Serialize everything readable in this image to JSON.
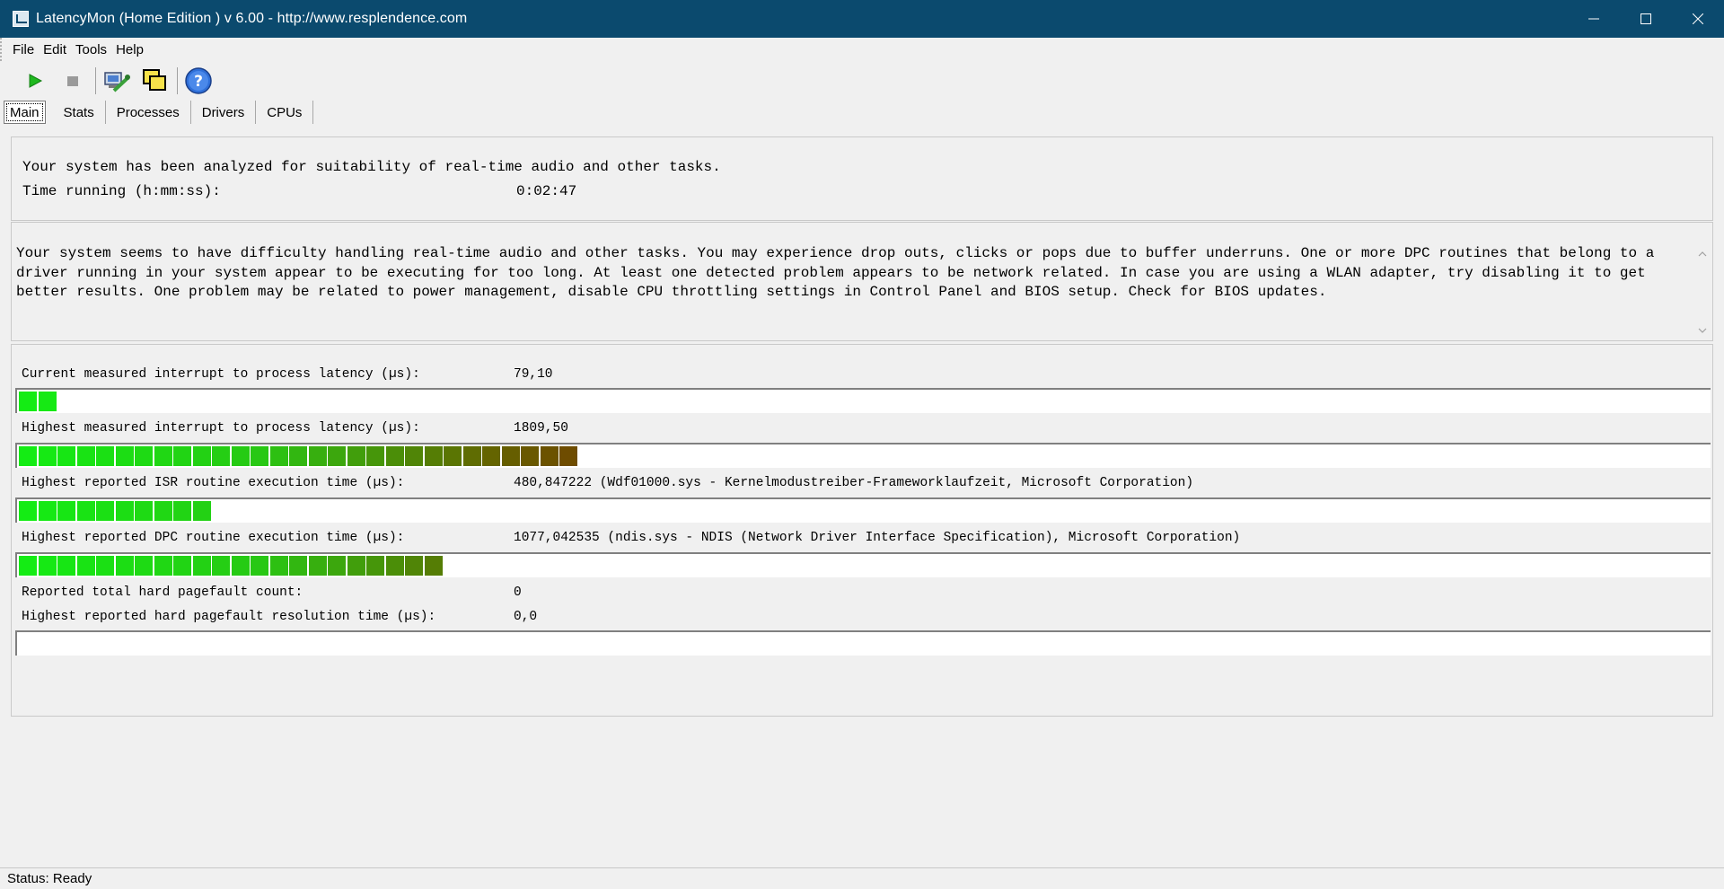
{
  "window": {
    "title": "LatencyMon  (Home Edition )  v 6.00 - http://www.resplendence.com"
  },
  "menu": {
    "items": [
      "File",
      "Edit",
      "Tools",
      "Help"
    ]
  },
  "toolbar": {
    "buttons": [
      {
        "name": "start-icon",
        "color": "#1fa01f"
      },
      {
        "name": "stop-icon",
        "color": "#909090"
      },
      {
        "name": "computer-tools-icon"
      },
      {
        "name": "windows-icon"
      },
      {
        "name": "help-icon",
        "color": "#2a6fd6"
      }
    ]
  },
  "tabs": [
    "Main",
    "Stats",
    "Processes",
    "Drivers",
    "CPUs"
  ],
  "summary": {
    "line1": "Your system has been analyzed for suitability of real-time audio and other tasks.",
    "time_label": "Time running (h:mm:ss):",
    "time_value": "0:02:47"
  },
  "advice": {
    "text": "Your system seems to have difficulty handling real-time audio and other tasks. You may experience drop outs, clicks or pops due to buffer underruns. One or more DPC routines that belong to a driver running in your system appear to be executing for too long. At least one detected problem appears to be network related. In case you are using a WLAN adapter, try disabling it to get better results. One problem may be related to power management, disable CPU throttling settings in Control Panel and BIOS setup. Check for BIOS updates."
  },
  "metrics": {
    "current_latency": {
      "label": "Current measured interrupt to process latency (µs):",
      "value": "79,10",
      "segments": 2
    },
    "highest_latency": {
      "label": "Highest measured interrupt to process latency (µs):",
      "value": "1809,50",
      "segments": 29
    },
    "isr": {
      "label": "Highest reported ISR routine execution time (µs):",
      "value": "480,847222  (Wdf01000.sys - Kernelmodustreiber-Frameworklaufzeit, Microsoft Corporation)",
      "segments": 10
    },
    "dpc": {
      "label": "Highest reported DPC routine execution time (µs):",
      "value": "1077,042535  (ndis.sys - NDIS (Network Driver Interface Specification), Microsoft Corporation)",
      "segments": 22
    },
    "pagefault_count": {
      "label": "Reported total hard pagefault count:",
      "value": "0"
    },
    "pagefault_time": {
      "label": "Highest reported hard pagefault resolution time (µs):",
      "value": "0,0",
      "segments": 0
    }
  },
  "status": {
    "text": "Status: Ready"
  }
}
